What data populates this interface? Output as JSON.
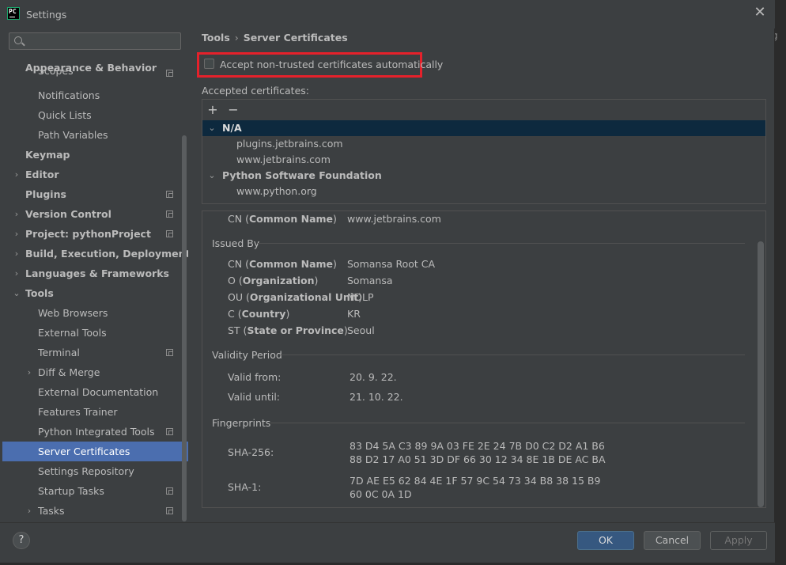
{
  "window": {
    "title": "Settings",
    "app_icon_text": "PC"
  },
  "search": {
    "placeholder": ""
  },
  "sidebar": {
    "items": [
      {
        "label": "Appearance & Behavior"
      },
      {
        "label": "Scopes"
      },
      {
        "label": "Notifications"
      },
      {
        "label": "Quick Lists"
      },
      {
        "label": "Path Variables"
      },
      {
        "label": "Keymap"
      },
      {
        "label": "Editor"
      },
      {
        "label": "Plugins"
      },
      {
        "label": "Version Control"
      },
      {
        "label": "Project: pythonProject"
      },
      {
        "label": "Build, Execution, Deployment"
      },
      {
        "label": "Languages & Frameworks"
      },
      {
        "label": "Tools"
      },
      {
        "label": "Web Browsers"
      },
      {
        "label": "External Tools"
      },
      {
        "label": "Terminal"
      },
      {
        "label": "Diff & Merge"
      },
      {
        "label": "External Documentation"
      },
      {
        "label": "Features Trainer"
      },
      {
        "label": "Python Integrated Tools"
      },
      {
        "label": "Server Certificates"
      },
      {
        "label": "Settings Repository"
      },
      {
        "label": "Startup Tasks"
      },
      {
        "label": "Tasks"
      }
    ]
  },
  "breadcrumb": {
    "parent": "Tools",
    "current": "Server Certificates"
  },
  "accept_checkbox": {
    "label": "Accept non-trusted certificates automatically",
    "checked": false
  },
  "accepted": {
    "label": "Accepted certificates:",
    "groups": [
      {
        "name": "N/A",
        "entries": [
          "plugins.jetbrains.com",
          "www.jetbrains.com"
        ]
      },
      {
        "name": "Python Software Foundation",
        "entries": [
          "www.python.org"
        ]
      }
    ]
  },
  "details": {
    "subject_cn_key": "CN",
    "subject_cn_name": "Common Name",
    "subject_cn_value": "www.jetbrains.com",
    "issued_by_title": "Issued By",
    "issued_by": [
      {
        "key": "CN",
        "name": "Common Name",
        "value": "Somansa Root CA"
      },
      {
        "key": "O",
        "name": "Organization",
        "value": "Somansa"
      },
      {
        "key": "OU",
        "name": "Organizational Unit",
        "value": "NDLP"
      },
      {
        "key": "C",
        "name": "Country",
        "value": "KR"
      },
      {
        "key": "ST",
        "name": "State or Province",
        "value": "Seoul"
      }
    ],
    "validity_title": "Validity Period",
    "valid_from_label": "Valid from:",
    "valid_from": "20. 9. 22.",
    "valid_until_label": "Valid until:",
    "valid_until": "21. 10. 22.",
    "fingerprints_title": "Fingerprints",
    "sha256_label": "SHA-256:",
    "sha256_line1": "83 D4 5A C3 89 9A 03 FE 2E 24 7B D0 C2 D2 A1 B6",
    "sha256_line2": "88 D2 17 A0 51 3D DF 66 30 12 34 8E 1B DE AC BA",
    "sha1_label": "SHA-1:",
    "sha1_line1": "7D AE E5 62 84 4E 1F 57 9C 54 73 34 B8 38 15 B9",
    "sha1_line2": "60 0C 0A 1D"
  },
  "footer": {
    "help_label": "?",
    "ok_label": "OK",
    "cancel_label": "Cancel",
    "apply_label": "Apply"
  },
  "outer_glyph": "g",
  "colors": {
    "selection": "#4b6eaf",
    "highlight_box": "#e5212b",
    "ok_button": "#365880"
  }
}
